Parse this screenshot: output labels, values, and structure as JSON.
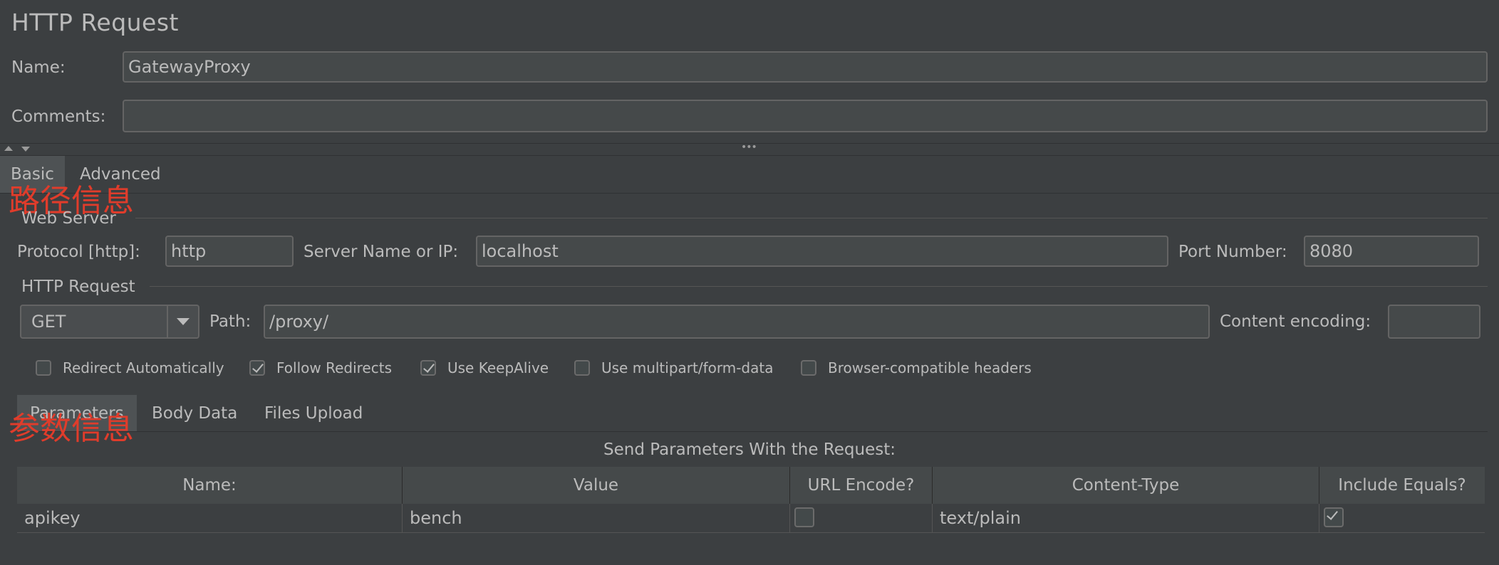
{
  "header": {
    "title": "HTTP Request",
    "name_label": "Name:",
    "name_value": "GatewayProxy",
    "comments_label": "Comments:",
    "comments_value": ""
  },
  "splitter": {
    "dots": "•••"
  },
  "tabs": {
    "basic": "Basic",
    "advanced": "Advanced"
  },
  "annotations": {
    "path_info": "路径信息",
    "param_info": "参数信息"
  },
  "web_server": {
    "section_label": "Web Server",
    "protocol_label": "Protocol [http]:",
    "protocol_value": "http",
    "server_label": "Server Name or IP:",
    "server_value": "localhost",
    "port_label": "Port Number:",
    "port_value": "8080"
  },
  "http_request": {
    "section_label": "HTTP Request",
    "method_value": "GET",
    "path_label": "Path:",
    "path_value": "/proxy/",
    "encoding_label": "Content encoding:",
    "encoding_value": ""
  },
  "checkboxes": [
    {
      "label": "Redirect Automatically",
      "checked": false
    },
    {
      "label": "Follow Redirects",
      "checked": true
    },
    {
      "label": "Use KeepAlive",
      "checked": true
    },
    {
      "label": "Use multipart/form-data",
      "checked": false
    },
    {
      "label": "Browser-compatible headers",
      "checked": false
    }
  ],
  "sub_tabs": {
    "parameters": "Parameters",
    "body_data": "Body Data",
    "files_upload": "Files Upload"
  },
  "params": {
    "caption": "Send Parameters With the Request:",
    "headers": [
      "Name:",
      "Value",
      "URL Encode?",
      "Content-Type",
      "Include Equals?"
    ],
    "rows": [
      {
        "name": "apikey",
        "value": "bench",
        "url_encode": false,
        "content_type": "text/plain",
        "include_equals": true
      }
    ]
  }
}
